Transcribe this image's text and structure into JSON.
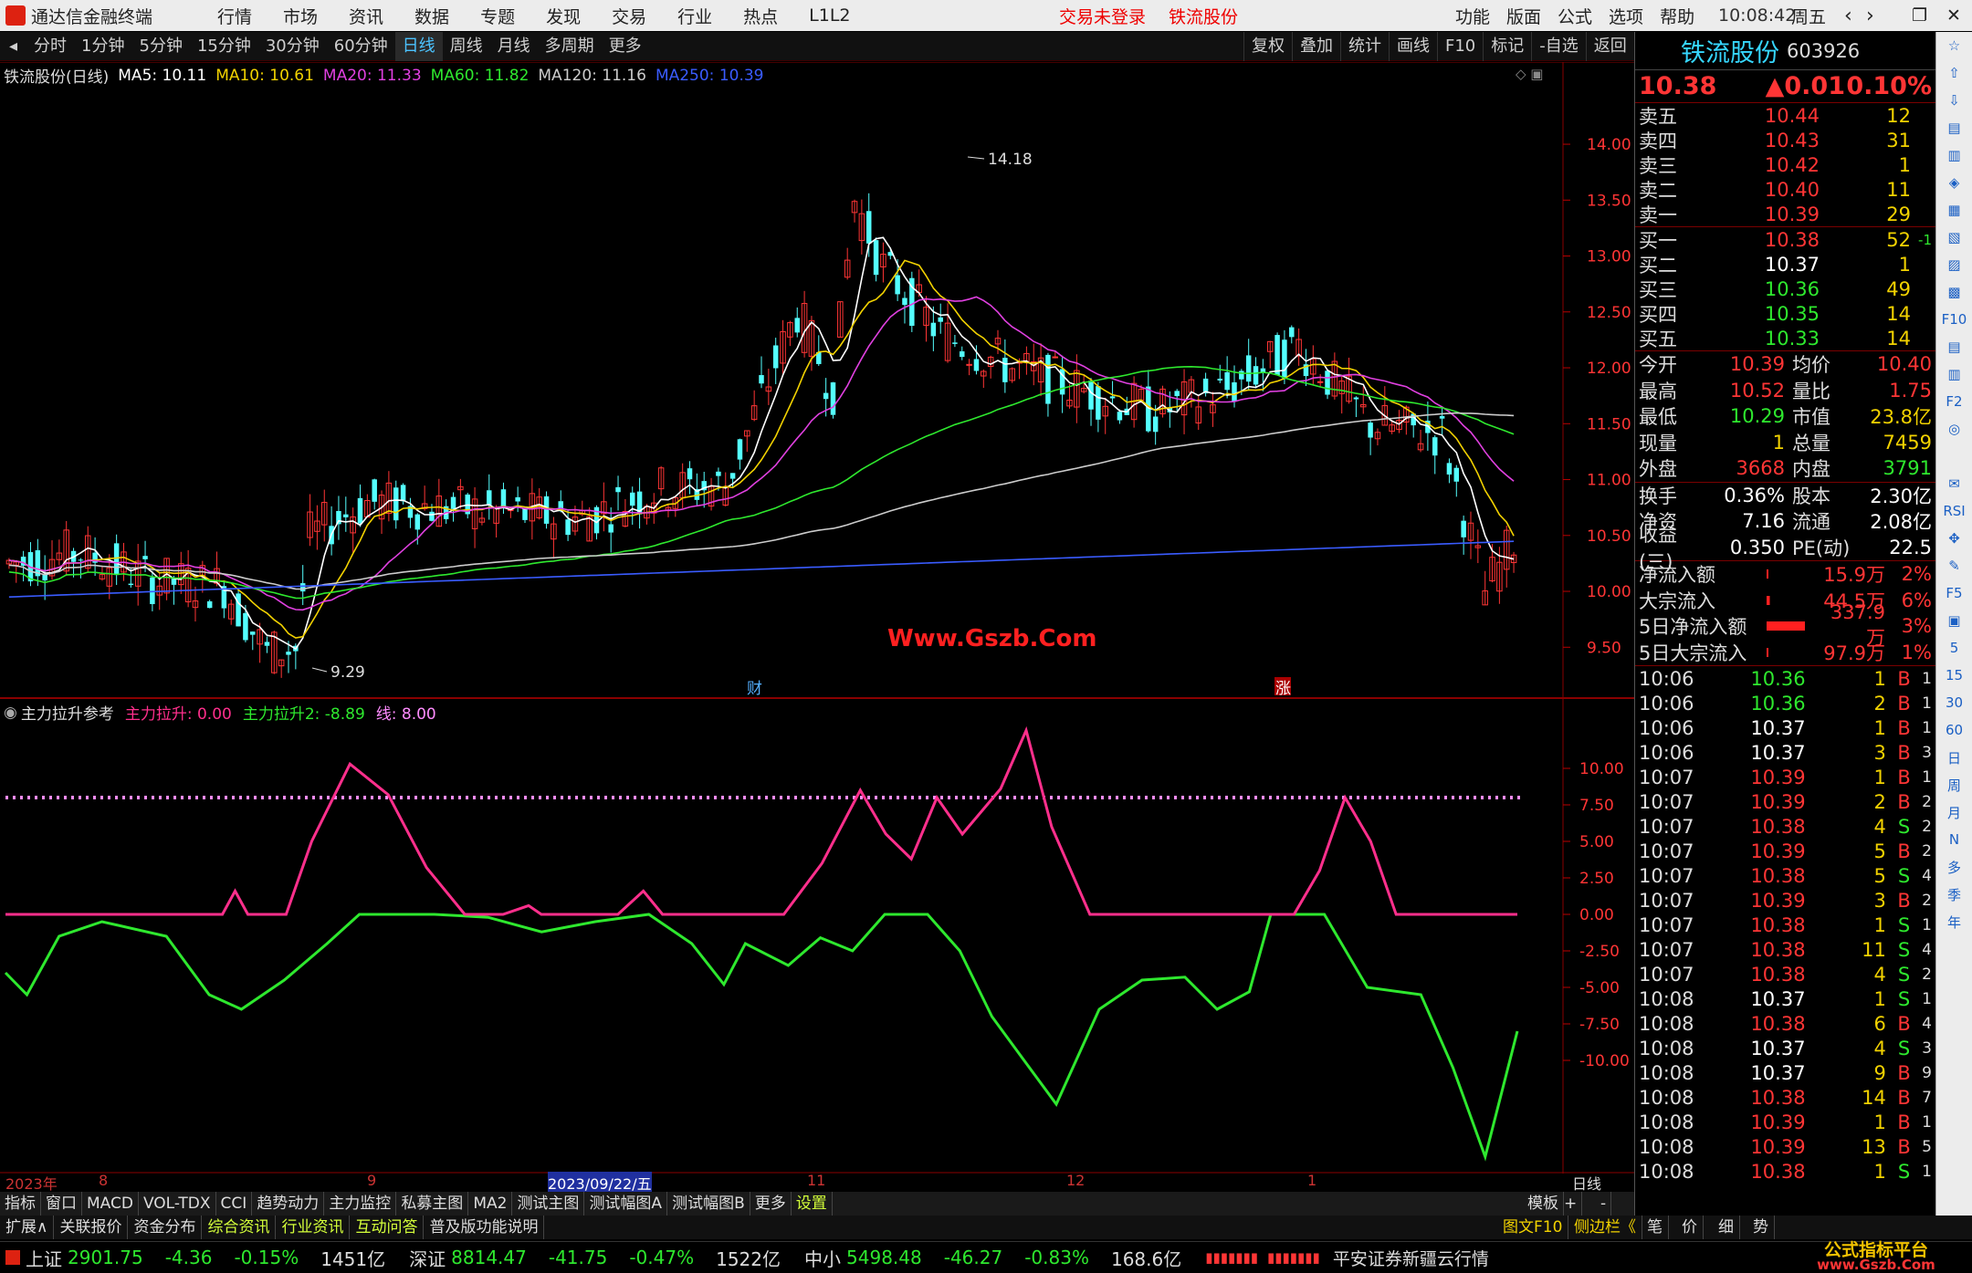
{
  "titlebar": {
    "app": "通达信金融终端",
    "menus": [
      "行情",
      "市场",
      "资讯",
      "数据",
      "专题",
      "发现",
      "交易",
      "行业",
      "热点",
      "L1L2"
    ],
    "trade_status": "交易未登录",
    "stock_name": "铁流股份",
    "right_menus": [
      "功能",
      "版面",
      "公式",
      "选项",
      "帮助"
    ],
    "time": "10:08:42",
    "weekday": "周五"
  },
  "periods": [
    "分时",
    "1分钟",
    "5分钟",
    "15分钟",
    "30分钟",
    "60分钟",
    "日线",
    "周线",
    "月线",
    "多周期",
    "更多"
  ],
  "active_period": "日线",
  "toolbar_right": [
    "复权",
    "叠加",
    "统计",
    "画线",
    "F10",
    "标记",
    "-自选",
    "返回"
  ],
  "main_chart": {
    "title": "铁流股份(日线)",
    "ma": [
      {
        "label": "MA5: 10.11",
        "color": "#ffffff"
      },
      {
        "label": "MA10: 10.61",
        "color": "#f2d200"
      },
      {
        "label": "MA20: 11.33",
        "color": "#e040e0"
      },
      {
        "label": "MA60: 11.82",
        "color": "#2ee82e"
      },
      {
        "label": "MA120: 11.16",
        "color": "#cccccc"
      },
      {
        "label": "MA250: 10.39",
        "color": "#3a5cff"
      }
    ],
    "high_label": "14.18",
    "low_label": "9.29",
    "watermark": "Www.Gszb.Com",
    "marker_cai": "财",
    "marker_zhang": "涨"
  },
  "chart_data": {
    "type": "candlestick",
    "ylim": [
      9.2,
      14.3
    ],
    "yticks": [
      "14.00",
      "13.50",
      "13.00",
      "12.50",
      "12.00",
      "11.50",
      "11.00",
      "10.50",
      "10.00",
      "9.50"
    ],
    "high": 14.18,
    "low": 9.29,
    "last": 10.38
  },
  "sub_chart": {
    "title": "主力拉升参考",
    "s1": "主力拉升: 0.00",
    "s2": "主力拉升2: -8.89",
    "s3": "线: 8.00",
    "yticks": [
      "10.00",
      "7.50",
      "5.00",
      "2.50",
      "0.00",
      "-2.50",
      "-5.00",
      "-7.50",
      "-10.00"
    ]
  },
  "xaxis": {
    "labels": [
      "2023年",
      "8",
      "9",
      "2023/09/22/五",
      "11",
      "12",
      "1"
    ],
    "right": "日线"
  },
  "tabs": [
    "指标",
    "窗口",
    "MACD",
    "VOL-TDX",
    "CCI",
    "趋势动力",
    "主力监控",
    "私募主图",
    "MA2",
    "测试主图",
    "测试幅图A",
    "测试幅图B",
    "更多",
    "设置"
  ],
  "tab_right": [
    "模板",
    "+",
    "-"
  ],
  "infotabs": [
    "扩展∧",
    "关联报价",
    "资金分布",
    "综合资讯",
    "行业资讯",
    "互动问答",
    "普及版功能说明"
  ],
  "info_right": [
    "图文F10",
    "侧边栏《",
    "笔",
    "价",
    "细",
    "势"
  ],
  "quote": {
    "name": "铁流股份",
    "code": "603926",
    "price": "10.38",
    "change": "▲0.01",
    "pct": "0.10%",
    "asks": [
      [
        "卖五",
        "10.44",
        "12"
      ],
      [
        "卖四",
        "10.43",
        "31"
      ],
      [
        "卖三",
        "10.42",
        "1"
      ],
      [
        "卖二",
        "10.40",
        "11"
      ],
      [
        "卖一",
        "10.39",
        "29"
      ]
    ],
    "bids": [
      [
        "买一",
        "10.38",
        "52",
        "-1"
      ],
      [
        "买二",
        "10.37",
        "1",
        ""
      ],
      [
        "买三",
        "10.36",
        "49",
        ""
      ],
      [
        "买四",
        "10.35",
        "14",
        ""
      ],
      [
        "买五",
        "10.33",
        "14",
        ""
      ]
    ],
    "stats": [
      [
        "今开",
        "10.39",
        "均价",
        "10.40"
      ],
      [
        "最高",
        "10.52",
        "量比",
        "1.75"
      ],
      [
        "最低",
        "10.29",
        "市值",
        "23.8亿"
      ],
      [
        "现量",
        "1",
        "总量",
        "7459"
      ],
      [
        "外盘",
        "3668",
        "内盘",
        "3791"
      ]
    ],
    "stats2": [
      [
        "换手",
        "0.36%",
        "股本",
        "2.30亿"
      ],
      [
        "净资",
        "7.16",
        "流通",
        "2.08亿"
      ],
      [
        "收益(三)",
        "0.350",
        "PE(动)",
        "22.5"
      ]
    ],
    "flows": [
      [
        "净流入额",
        "15.9万",
        "2%"
      ],
      [
        "大宗流入",
        "44.5万",
        "6%"
      ],
      [
        "5日净流入额",
        "337.9万",
        "3%"
      ],
      [
        "5日大宗流入",
        "97.9万",
        "1%"
      ]
    ],
    "ticks": [
      [
        "10:06",
        "10.36",
        "1",
        "B",
        "1"
      ],
      [
        "10:06",
        "10.36",
        "2",
        "B",
        "1"
      ],
      [
        "10:06",
        "10.37",
        "1",
        "B",
        "1"
      ],
      [
        "10:06",
        "10.37",
        "3",
        "B",
        "3"
      ],
      [
        "10:07",
        "10.39",
        "1",
        "B",
        "1"
      ],
      [
        "10:07",
        "10.39",
        "2",
        "B",
        "2"
      ],
      [
        "10:07",
        "10.38",
        "4",
        "S",
        "2"
      ],
      [
        "10:07",
        "10.39",
        "5",
        "B",
        "2"
      ],
      [
        "10:07",
        "10.38",
        "5",
        "S",
        "4"
      ],
      [
        "10:07",
        "10.39",
        "3",
        "B",
        "2"
      ],
      [
        "10:07",
        "10.38",
        "1",
        "S",
        "1"
      ],
      [
        "10:07",
        "10.38",
        "11",
        "S",
        "4"
      ],
      [
        "10:07",
        "10.38",
        "4",
        "S",
        "2"
      ],
      [
        "10:08",
        "10.37",
        "1",
        "S",
        "1"
      ],
      [
        "10:08",
        "10.38",
        "6",
        "B",
        "4"
      ],
      [
        "10:08",
        "10.37",
        "4",
        "S",
        "3"
      ],
      [
        "10:08",
        "10.37",
        "9",
        "B",
        "9"
      ],
      [
        "10:08",
        "10.38",
        "14",
        "B",
        "7"
      ],
      [
        "10:08",
        "10.39",
        "1",
        "B",
        "1"
      ],
      [
        "10:08",
        "10.39",
        "13",
        "B",
        "5"
      ],
      [
        "10:08",
        "10.38",
        "1",
        "S",
        "1"
      ]
    ]
  },
  "sidebar": [
    "☆",
    "⇧",
    "⇩",
    "▤",
    "▥",
    "◈",
    "▦",
    "▧",
    "▨",
    "▩",
    "F10",
    "▤",
    "▥",
    "F2",
    "◎",
    "",
    "✉",
    "RSI",
    "✥",
    "✎",
    "F5",
    "▣",
    "5",
    "15",
    "30",
    "60",
    "日",
    "周",
    "月",
    "N",
    "多",
    "季",
    "年"
  ],
  "status": {
    "sh_label": "上证",
    "sh": "2901.75",
    "sh_chg": "-4.36",
    "sh_pct": "-0.15%",
    "sh_amt": "1451亿",
    "sz_label": "深证",
    "sz": "8814.47",
    "sz_chg": "-41.75",
    "sz_pct": "-0.47%",
    "sz_amt": "1522亿",
    "zx_label": "中小",
    "zx": "5498.48",
    "zx_chg": "-46.27",
    "zx_pct": "-0.83%",
    "zx_amt": "168.6亿",
    "broker": "平安证券新疆云行情",
    "logo": "公式指标平台",
    "logo_url": "www.Gszb.Com"
  }
}
